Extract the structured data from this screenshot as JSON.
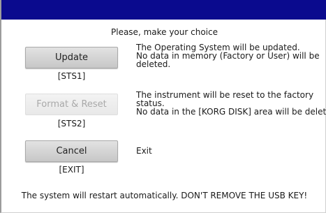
{
  "header": {
    "bar_color": "#0a0a8e"
  },
  "prompt": "Please, make your choice",
  "options": [
    {
      "label": "Update",
      "code": "[STS1]",
      "enabled": true,
      "description": [
        "The Operating System will be updated.",
        "No data in memory (Factory or User) will be",
        "deleted."
      ]
    },
    {
      "label": "Format & Reset",
      "code": "[STS2]",
      "enabled": false,
      "description": [
        "The instrument will be reset to the factory",
        "status.",
        "No data in the [KORG DISK] area will be deleted."
      ]
    },
    {
      "label": "Cancel",
      "code": "[EXIT]",
      "enabled": true,
      "description": [
        "Exit"
      ]
    }
  ],
  "footer": "The system will restart automatically. DON'T REMOVE THE USB KEY!"
}
